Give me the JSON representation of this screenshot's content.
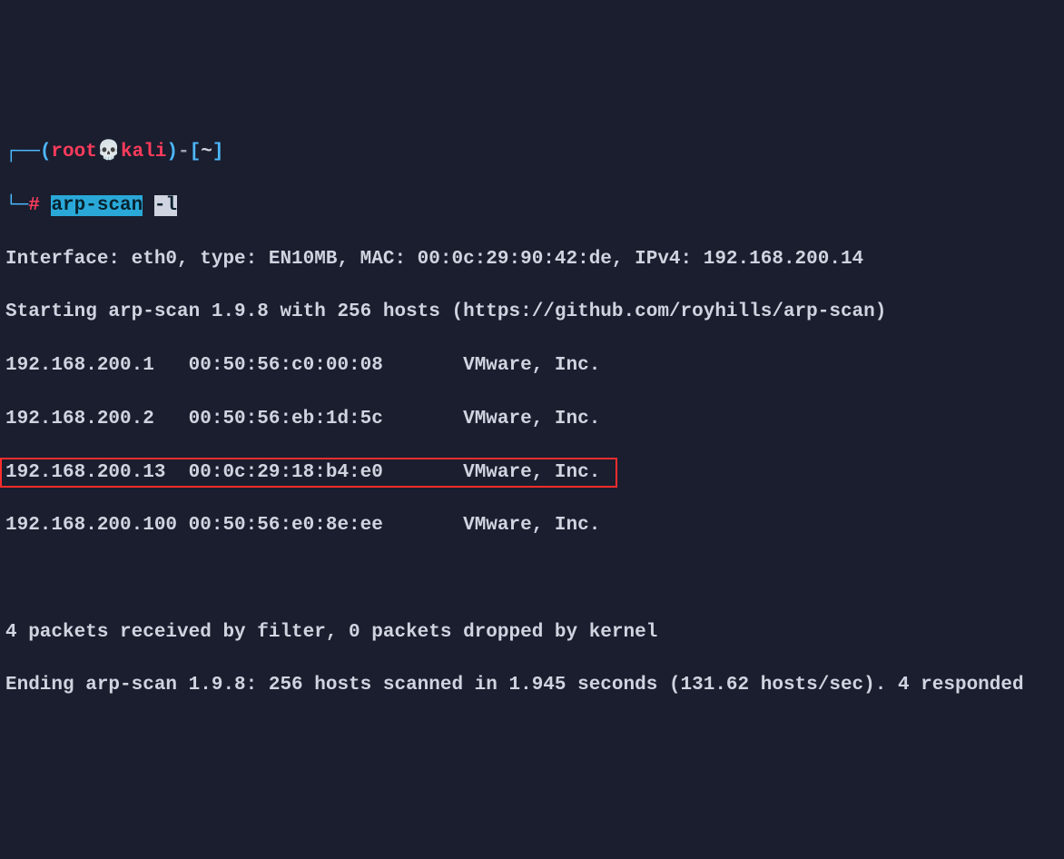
{
  "prompt": {
    "box_top": "┌──",
    "paren_open": "(",
    "user": "root",
    "skull": "💀",
    "host": "kali",
    "paren_close": ")",
    "dash": "-",
    "bracket_open": "[",
    "tilde": "~",
    "bracket_close": "]",
    "box_bottom": "└─",
    "hash": "#",
    "command": "arp-scan",
    "flag": "-l"
  },
  "output": {
    "interface_line": "Interface: eth0, type: EN10MB, MAC: 00:0c:29:90:42:de, IPv4: 192.168.200.14",
    "starting_line": "Starting arp-scan 1.9.8 with 256 hosts (https://github.com/royhills/arp-scan)",
    "rows": [
      {
        "ip": "192.168.200.1  ",
        "mac": " 00:50:56:c0:00:08",
        "vendor": "       VMware, Inc."
      },
      {
        "ip": "192.168.200.2  ",
        "mac": " 00:50:56:eb:1d:5c",
        "vendor": "       VMware, Inc."
      },
      {
        "ip": "192.168.200.13 ",
        "mac": " 00:0c:29:18:b4:e0",
        "vendor": "       VMware, Inc."
      },
      {
        "ip": "192.168.200.100",
        "mac": " 00:50:56:e0:8e:ee",
        "vendor": "       VMware, Inc."
      }
    ],
    "packets_line": "4 packets received by filter, 0 packets dropped by kernel",
    "ending_line": "Ending arp-scan 1.9.8: 256 hosts scanned in 1.945 seconds (131.62 hosts/sec). 4 responded"
  }
}
